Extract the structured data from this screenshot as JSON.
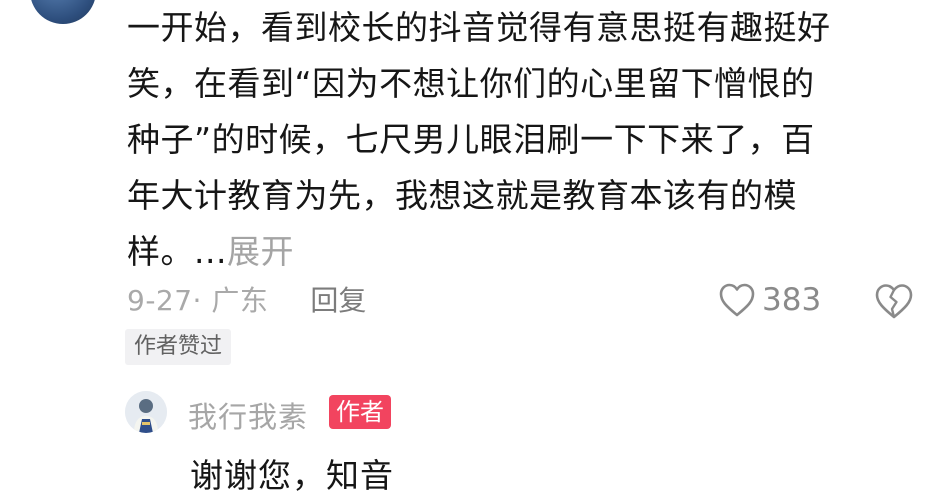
{
  "comment": {
    "lines": [
      "一开始，看到校长的抖音觉得有意思挺有趣挺好",
      "笑，在看到“因为不想让你们的心里留下憎恨的",
      "种子”的时候，七尺男儿眼泪刷一下下来了，百",
      "年大计教育为先，我想这就是教育本该有的模",
      "样。..."
    ],
    "expand_label": "展开",
    "date_location": "9-27· 广东",
    "reply_label": "回复",
    "like_count": "383",
    "author_liked_tag": "作者赞过"
  },
  "reply": {
    "username": "我行我素",
    "author_badge": "作者",
    "text": "谢谢您，知音"
  },
  "icons": {
    "like": "heart-outline-icon",
    "dislike": "broken-heart-icon",
    "avatar_top": "avatar-image",
    "avatar_reply": "avatar-image"
  },
  "colors": {
    "text": "#161616",
    "muted": "#a9a9a9",
    "badge": "#f2445f",
    "tag_bg": "#f1f1f3"
  }
}
